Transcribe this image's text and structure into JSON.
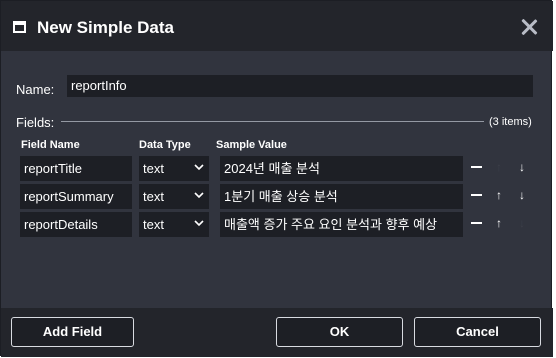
{
  "dialog": {
    "title": "New Simple Data",
    "window_icon": "window-icon",
    "close_icon": "close-icon"
  },
  "name": {
    "label": "Name:",
    "value": "reportInfo"
  },
  "fields": {
    "label": "Fields:",
    "count": "(3 items)",
    "headers": {
      "name": "Field Name",
      "type": "Data Type",
      "sample": "Sample Value"
    },
    "rows": [
      {
        "name": "reportTitle",
        "type": "text",
        "sample": "2024년 매출 분석"
      },
      {
        "name": "reportSummary",
        "type": "text",
        "sample": "1분기 매출 상승 분석"
      },
      {
        "name": "reportDetails",
        "type": "text",
        "sample": "매출액 증가 주요 요인 분석과 향후 예상"
      }
    ],
    "row_controls": {
      "remove": "minus-icon",
      "up": "↑",
      "down": "↓"
    }
  },
  "buttons": {
    "add_field": "Add Field",
    "ok": "OK",
    "cancel": "Cancel"
  },
  "colors": {
    "background": "#31343e",
    "titlebar": "#23252b",
    "input": "#1d1f25",
    "text": "#ffffff"
  }
}
